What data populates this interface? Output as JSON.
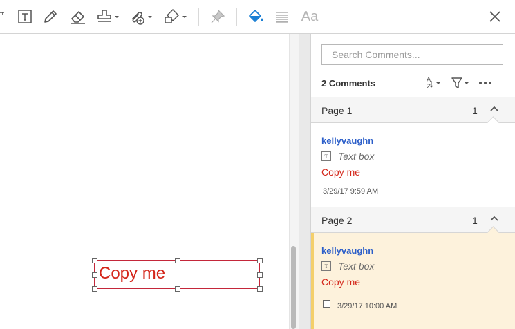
{
  "toolbar": {
    "items": [
      {
        "name": "typewriter-tool",
        "icon": "partial-typewriter-icon"
      },
      {
        "name": "text-box-tool",
        "icon": "text-box-icon"
      },
      {
        "name": "pencil-tool",
        "icon": "pencil-icon"
      },
      {
        "name": "eraser-tool",
        "icon": "eraser-icon"
      },
      {
        "name": "stamp-tool",
        "icon": "stamp-icon"
      },
      {
        "name": "attach-tool",
        "icon": "paperclip-add-icon"
      },
      {
        "name": "shapes-tool",
        "icon": "shapes-icon"
      },
      {
        "name": "pin-tool",
        "icon": "pin-icon"
      },
      {
        "name": "fill-color-tool",
        "icon": "paint-bucket-icon"
      },
      {
        "name": "line-style-tool",
        "icon": "line-style-icon"
      },
      {
        "name": "font-tool",
        "icon": "font-aa-icon"
      },
      {
        "name": "close-button",
        "icon": "close-icon"
      }
    ],
    "font_label": "Aa",
    "accent_color": "#1a7fd4"
  },
  "document": {
    "textbox_text": "Copy me",
    "textbox_color": "#d4261a",
    "border_color": "#c4273a"
  },
  "panel": {
    "search_placeholder": "Search Comments...",
    "comment_count": "2 Comments",
    "sort_label": "AZ",
    "pages": [
      {
        "label": "Page 1",
        "count": "1",
        "selected": false,
        "comment": {
          "author": "kellyvaughn",
          "type": "Text box",
          "text": "Copy me",
          "date": "3/29/17  9:59 AM"
        }
      },
      {
        "label": "Page 2",
        "count": "1",
        "selected": true,
        "comment": {
          "author": "kellyvaughn",
          "type": "Text box",
          "text": "Copy me",
          "date": "3/29/17  10:00 AM",
          "checked": false
        }
      }
    ]
  }
}
